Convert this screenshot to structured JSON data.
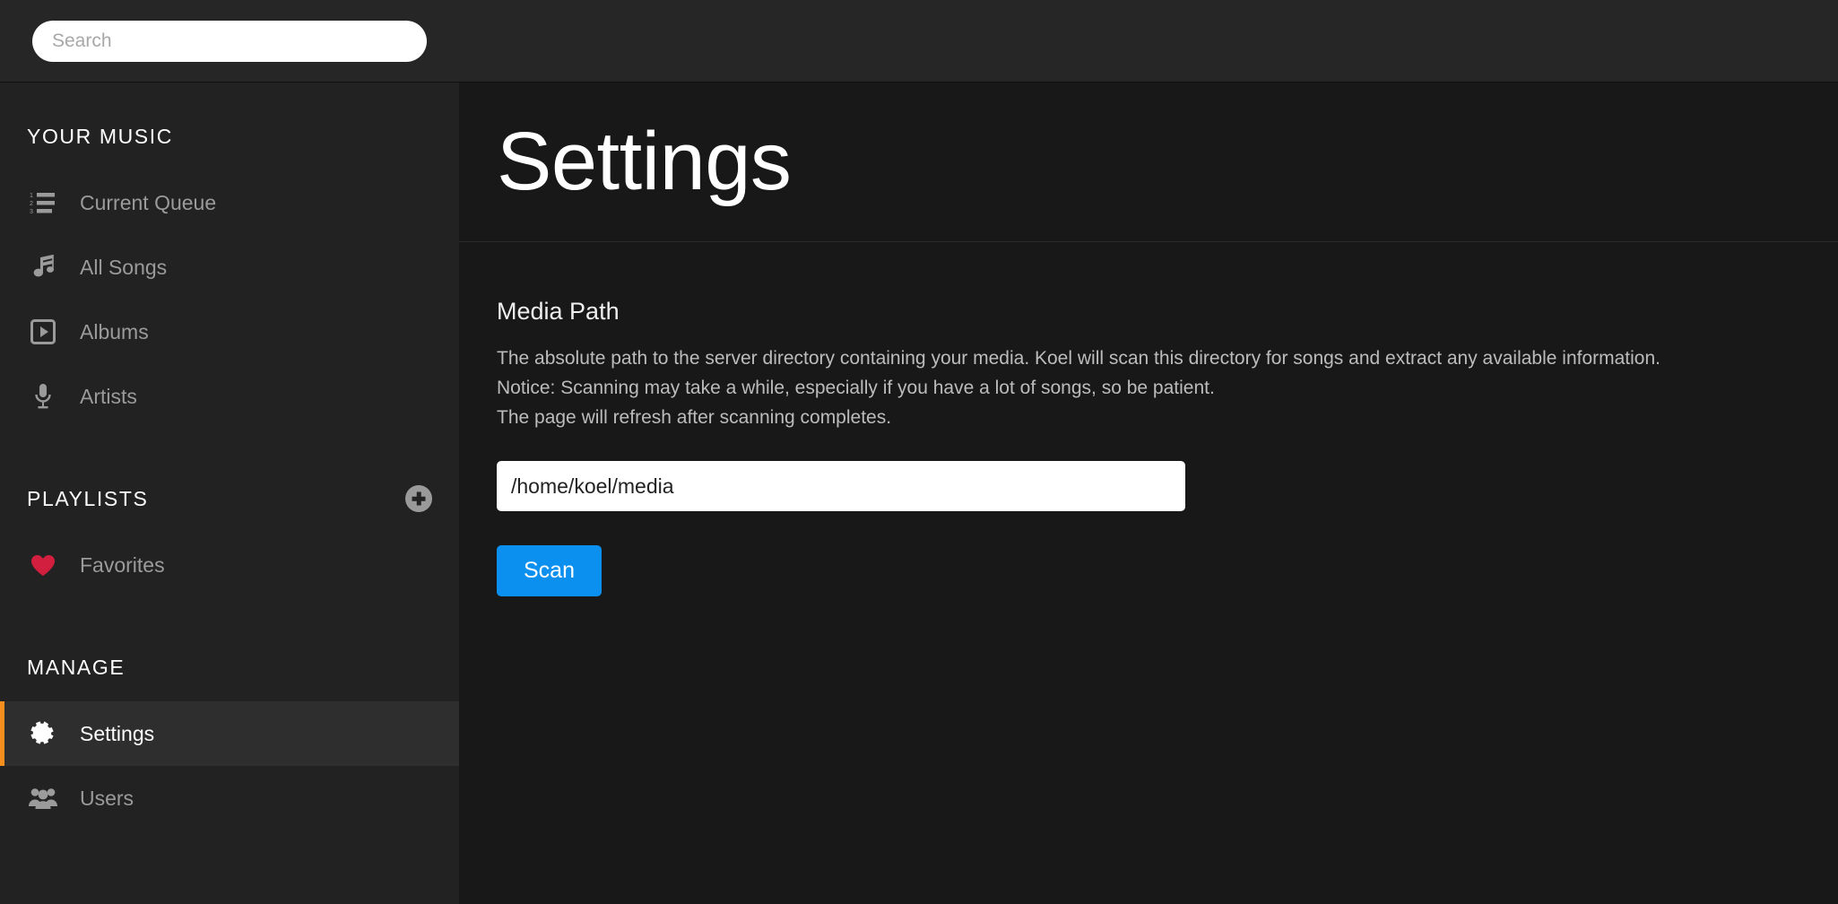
{
  "search": {
    "placeholder": "Search",
    "value": ""
  },
  "sidebar": {
    "sections": [
      {
        "title": "YOUR MUSIC",
        "has_add_button": false,
        "items": [
          {
            "label": "Current Queue",
            "icon": "numbered-list-icon",
            "active": false
          },
          {
            "label": "All Songs",
            "icon": "music-note-icon",
            "active": false
          },
          {
            "label": "Albums",
            "icon": "album-play-icon",
            "active": false
          },
          {
            "label": "Artists",
            "icon": "microphone-icon",
            "active": false
          }
        ]
      },
      {
        "title": "PLAYLISTS",
        "has_add_button": true,
        "add_button_label": "+",
        "items": [
          {
            "label": "Favorites",
            "icon": "heart-icon",
            "active": false
          }
        ]
      },
      {
        "title": "MANAGE",
        "has_add_button": false,
        "items": [
          {
            "label": "Settings",
            "icon": "gear-icon",
            "active": true
          },
          {
            "label": "Users",
            "icon": "users-group-icon",
            "active": false
          }
        ]
      }
    ]
  },
  "main": {
    "title": "Settings",
    "media_path": {
      "label": "Media Path",
      "description_line_1": "The absolute path to the server directory containing your media. Koel will scan this directory for songs and extract any available information.",
      "description_line_2": "Notice: Scanning may take a while, especially if you have a lot of songs, so be patient.",
      "description_line_3": "The page will refresh after scanning completes.",
      "input_value": "/home/koel/media",
      "input_placeholder": "/home/koel/media",
      "scan_button_label": "Scan"
    }
  },
  "colors": {
    "accent_orange": "#f78f1e",
    "primary_blue": "#0b90ef",
    "favorite_red": "#d31f3f",
    "sidebar_bg": "#222222",
    "main_bg": "#181818",
    "topbar_bg": "#262626"
  }
}
